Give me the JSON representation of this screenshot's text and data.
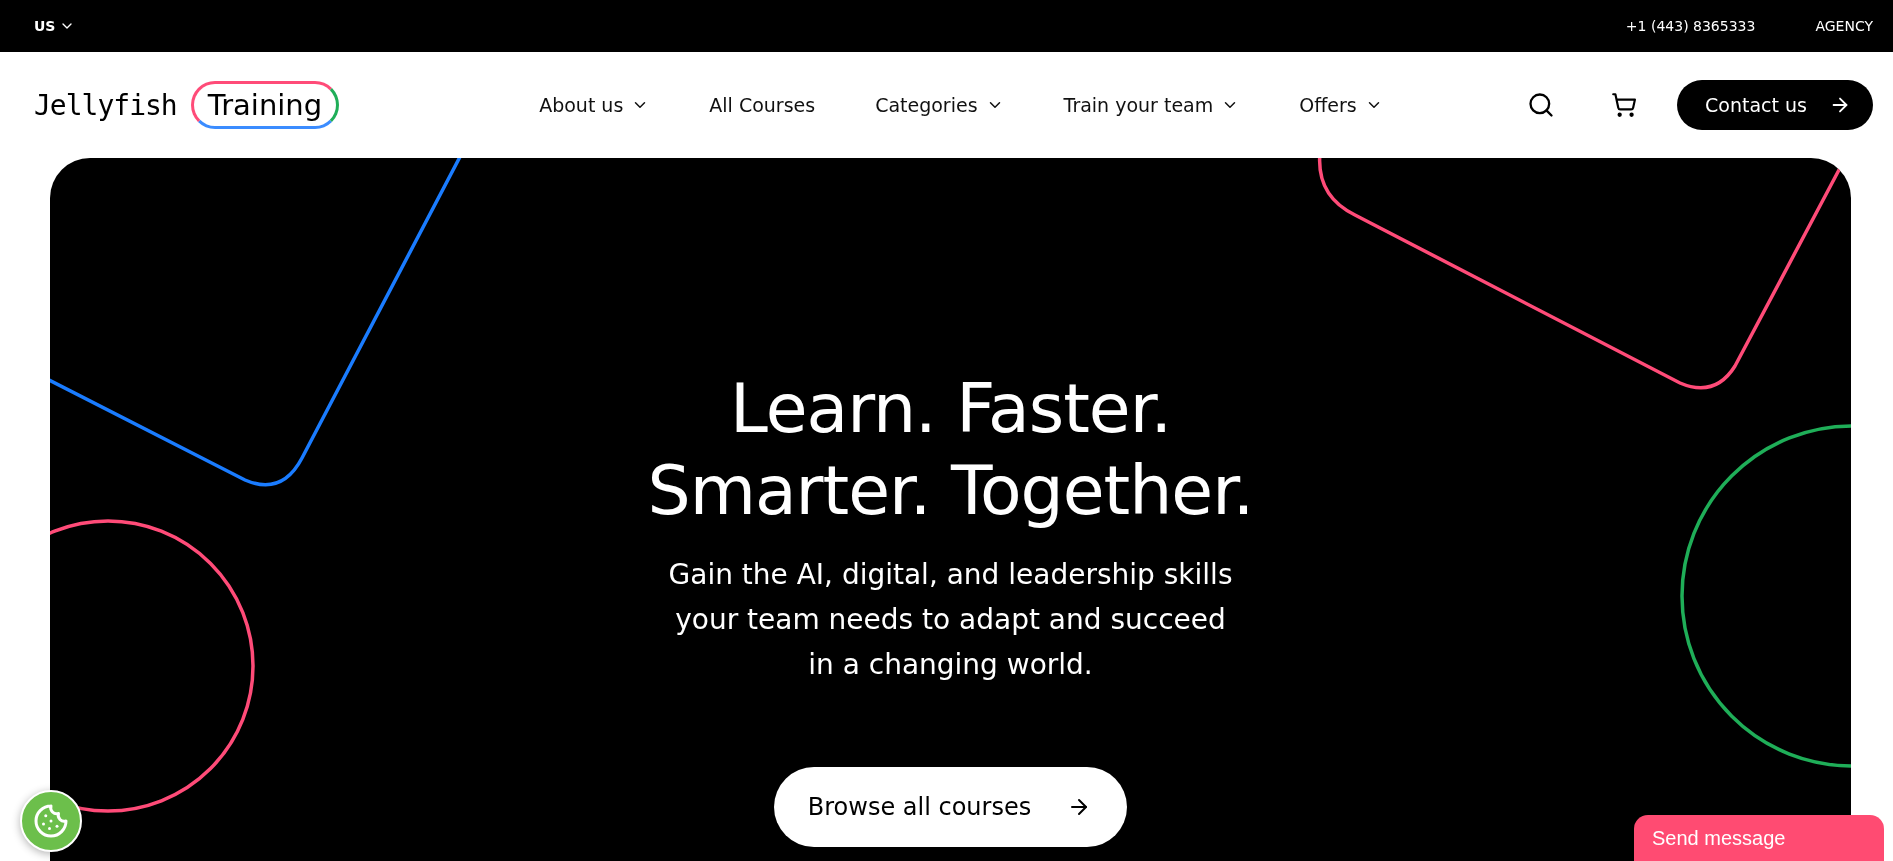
{
  "top_bar": {
    "region": "US",
    "phone": "+1 (443) 8365333",
    "agency": "AGENCY"
  },
  "header": {
    "logo": {
      "brand": "Jellyfish",
      "product": "Training"
    },
    "nav": [
      {
        "label": "About us",
        "has_menu": true
      },
      {
        "label": "All Courses",
        "has_menu": false
      },
      {
        "label": "Categories",
        "has_menu": true
      },
      {
        "label": "Train your team",
        "has_menu": true
      },
      {
        "label": "Offers",
        "has_menu": true
      }
    ],
    "contact_button": "Contact us"
  },
  "hero": {
    "title_lines": [
      "Learn. Faster.",
      "Smarter. Together."
    ],
    "subtitle_lines": [
      "Gain the AI, digital, and leadership skills",
      "your team needs to adapt and succeed",
      "in a changing world."
    ],
    "button": "Browse all courses"
  },
  "chat_button": "Send message"
}
